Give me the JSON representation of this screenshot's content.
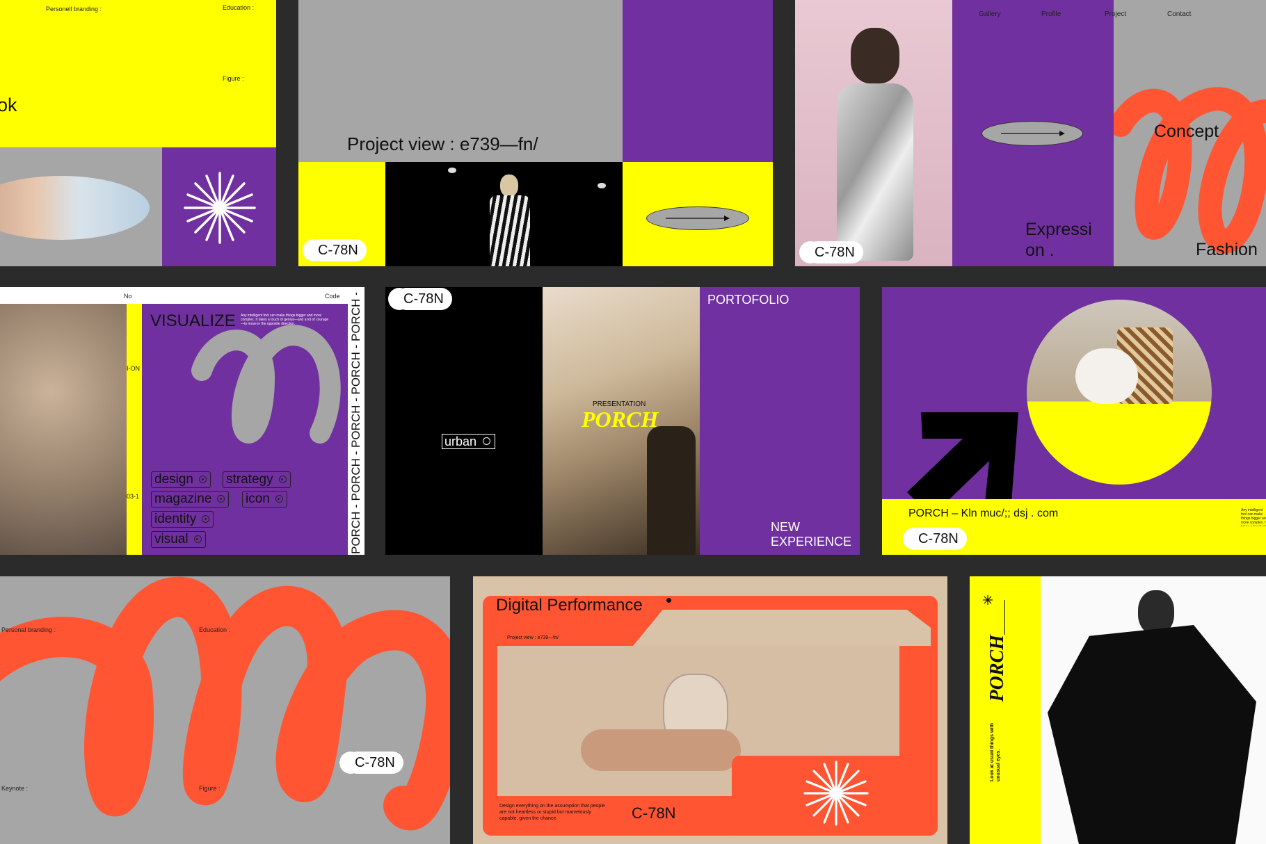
{
  "colors": {
    "yellow": "#ffff00",
    "purple": "#7030a0",
    "gray": "#a6a6a6",
    "orange": "#ff5533",
    "background": "#2b2b2b"
  },
  "code": "C-78N",
  "p1": {
    "personal": "Personell branding :",
    "education": "Education :",
    "figure": "Figure :",
    "partial_title": "ok",
    "icon": "starburst-icon"
  },
  "p2": {
    "title": "Project view : e739—fn/",
    "arrow_icon": "arrow-right-icon"
  },
  "p3": {
    "nav": [
      "Gallery",
      "Profile",
      "Project",
      "Contact"
    ],
    "expression": "Expressi on .",
    "concept": "Concept",
    "fashion": "Fashion"
  },
  "p4": {
    "no": "No",
    "code_label": "Code",
    "ion": "I-ON",
    "num": "03-1",
    "title": "VISUALIZE",
    "blurb": "Any intelligent fool can make things bigger and more complex. It takes a touch of genius—and a lot of courage—to move in the opposite direction.",
    "tags": [
      "design",
      "strategy",
      "magazine",
      "icon",
      "identity",
      "visual"
    ],
    "porch_strip": "PORCH - PORCH - PORCH - PORCH - PORCH -"
  },
  "p5": {
    "urban": "urban",
    "presentation": "PRESENTATION",
    "porch": "PORCH",
    "portofolio": "PORTOFOLIO",
    "new": "NEW",
    "experience": "EXPERIENCE"
  },
  "p6": {
    "line": "PORCH – Kln muc/;; dsj . com",
    "blurb": "Any intelligent fool can make things bigger and more complex. It takes a touch of genius—and a lot of courage—to move in the opposite direction."
  },
  "p7": {
    "personal": "Personal branding :",
    "education": "Education :",
    "keynote": "Keynote :",
    "figure": "Figure :"
  },
  "p8": {
    "title": "Digital Performance",
    "sub": "Project view : e739—fn/",
    "caption": "Design everything on the assumption that people are not heartless or stupid but marvelously capable, given the chance."
  },
  "p9": {
    "porch": "PORCH",
    "tagline": "Look at usual things with unusual eyes."
  }
}
